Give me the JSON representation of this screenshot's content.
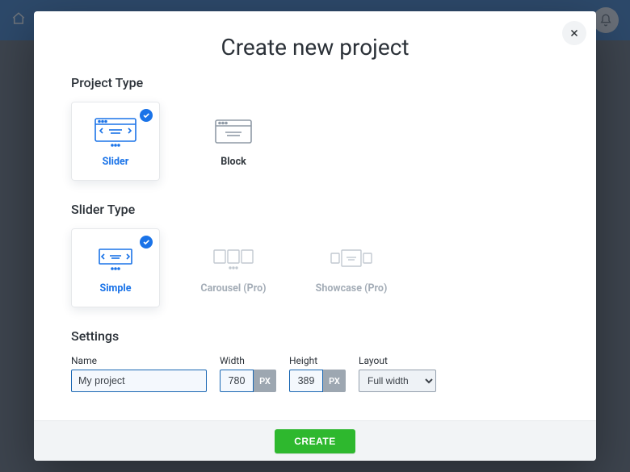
{
  "modal": {
    "title": "Create new project",
    "close_aria": "Close"
  },
  "project_type": {
    "heading": "Project Type",
    "options": [
      {
        "label": "Slider",
        "selected": true
      },
      {
        "label": "Block",
        "selected": false
      }
    ]
  },
  "slider_type": {
    "heading": "Slider Type",
    "options": [
      {
        "label": "Simple",
        "selected": true,
        "pro": false
      },
      {
        "label": "Carousel (Pro)",
        "selected": false,
        "pro": true
      },
      {
        "label": "Showcase (Pro)",
        "selected": false,
        "pro": true
      }
    ]
  },
  "settings": {
    "heading": "Settings",
    "name_label": "Name",
    "name_value": "My project",
    "width_label": "Width",
    "width_value": "780",
    "width_unit": "PX",
    "height_label": "Height",
    "height_value": "389",
    "height_unit": "PX",
    "layout_label": "Layout",
    "layout_value": "Full width"
  },
  "footer": {
    "create_label": "CREATE"
  },
  "colors": {
    "accent": "#1a73e8",
    "topbar": "#1565c0",
    "create": "#2eb82e"
  }
}
